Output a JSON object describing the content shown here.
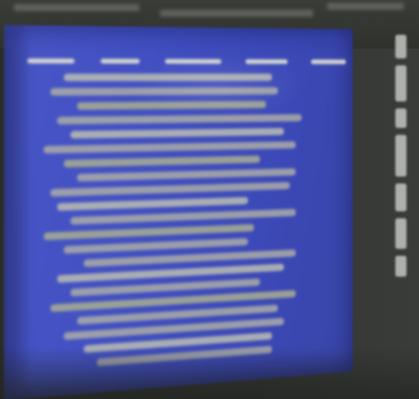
{
  "screen": {
    "colors": {
      "background": "#2b2d2a",
      "screen": "#4250c2",
      "text_glow": "#a9aba8"
    },
    "text_lines": [
      {
        "shade": "bright"
      },
      {
        "shade": "normal"
      },
      {
        "shade": "greenish"
      },
      {
        "shade": "normal"
      },
      {
        "shade": "bright"
      },
      {
        "shade": "normal"
      },
      {
        "shade": "greenish"
      },
      {
        "shade": "normal"
      },
      {
        "shade": "normal"
      },
      {
        "shade": "bright"
      },
      {
        "shade": "normal"
      },
      {
        "shade": "greenish"
      },
      {
        "shade": "normal"
      },
      {
        "shade": "normal"
      },
      {
        "shade": "bright"
      },
      {
        "shade": "normal"
      },
      {
        "shade": "greenish"
      },
      {
        "shade": "normal"
      },
      {
        "shade": "normal"
      },
      {
        "shade": "bright"
      },
      {
        "shade": "normal"
      }
    ]
  }
}
